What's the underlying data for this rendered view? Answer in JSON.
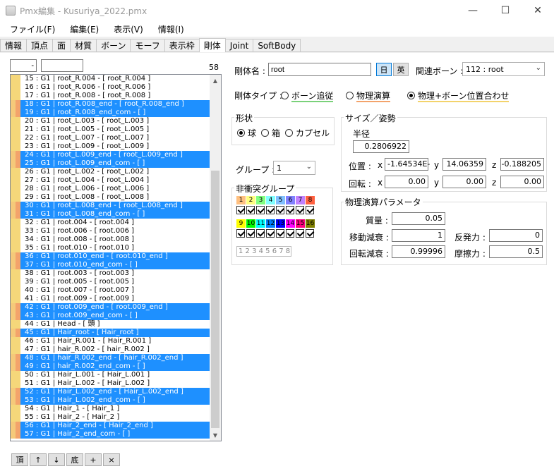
{
  "window": {
    "title": "Pmx編集 - Kusuriya_2022.pmx"
  },
  "menu": [
    "ファイル(F)",
    "編集(E)",
    "表示(V)",
    "情報(I)"
  ],
  "tabs": [
    "情報",
    "頂点",
    "面",
    "材質",
    "ボーン",
    "モーフ",
    "表示枠",
    "剛体",
    "Joint",
    "SoftBody"
  ],
  "active_tab": "剛体",
  "list": {
    "filter_value": "-",
    "count": "58",
    "rows": [
      {
        "t": "15 : G1  | root_R.004  - [ root_R.004 ]",
        "sel": false
      },
      {
        "t": "16 : G1  | root_R.006  - [ root_R.006 ]",
        "sel": false
      },
      {
        "t": "17 : G1  | root_R.008  - [ root_R.008 ]",
        "sel": false
      },
      {
        "t": "18 : G1  | root_R.008_end  - [ root_R.008_end ]",
        "sel": true
      },
      {
        "t": "19 : G1  | root_R.008_end_com  - [  ]",
        "sel": true
      },
      {
        "t": "20 : G1  | root_L.003  - [ root_L.003 ]",
        "sel": false
      },
      {
        "t": "21 : G1  | root_L.005  - [ root_L.005 ]",
        "sel": false
      },
      {
        "t": "22 : G1  | root_L.007  - [ root_L.007 ]",
        "sel": false
      },
      {
        "t": "23 : G1  | root_L.009  - [ root_L.009 ]",
        "sel": false
      },
      {
        "t": "24 : G1  | root_L.009_end  - [ root_L.009_end ]",
        "sel": true
      },
      {
        "t": "25 : G1  | root_L.009_end_com  - [  ]",
        "sel": true
      },
      {
        "t": "26 : G1  | root_L.002  - [ root_L.002 ]",
        "sel": false
      },
      {
        "t": "27 : G1  | root_L.004  - [ root_L.004 ]",
        "sel": false
      },
      {
        "t": "28 : G1  | root_L.006  - [ root_L.006 ]",
        "sel": false
      },
      {
        "t": "29 : G1  | root_L.008  - [ root_L.008 ]",
        "sel": false
      },
      {
        "t": "30 : G1  | root_L.008_end  - [ root_L.008_end ]",
        "sel": true
      },
      {
        "t": "31 : G1  | root_L.008_end_com  - [  ]",
        "sel": true
      },
      {
        "t": "32 : G1  | root.004  - [ root.004 ]",
        "sel": false
      },
      {
        "t": "33 : G1  | root.006  - [ root.006 ]",
        "sel": false
      },
      {
        "t": "34 : G1  | root.008  - [ root.008 ]",
        "sel": false
      },
      {
        "t": "35 : G1  | root.010  - [ root.010 ]",
        "sel": false
      },
      {
        "t": "36 : G1  | root.010_end  - [ root.010_end ]",
        "sel": true
      },
      {
        "t": "37 : G1  | root.010_end_com  - [  ]",
        "sel": true
      },
      {
        "t": "38 : G1  | root.003  - [ root.003 ]",
        "sel": false
      },
      {
        "t": "39 : G1  | root.005  - [ root.005 ]",
        "sel": false
      },
      {
        "t": "40 : G1  | root.007  - [ root.007 ]",
        "sel": false
      },
      {
        "t": "41 : G1  | root.009  - [ root.009 ]",
        "sel": false
      },
      {
        "t": "42 : G1  | root.009_end  - [ root.009_end ]",
        "sel": true
      },
      {
        "t": "43 : G1  | root.009_end_com  - [  ]",
        "sel": true
      },
      {
        "t": "44 : G1  | Head  - [ 頭 ]",
        "sel": false
      },
      {
        "t": "45 : G1  | Hair_root  - [ Hair_root ]",
        "sel": true
      },
      {
        "t": "46 : G1  | Hair_R.001  - [ Hair_R.001 ]",
        "sel": false
      },
      {
        "t": "47 : G1  | hair_R.002  - [ hair_R.002 ]",
        "sel": false
      },
      {
        "t": "48 : G1  | hair_R.002_end  - [ hair_R.002_end ]",
        "sel": true
      },
      {
        "t": "49 : G1  | hair_R.002_end_com  - [  ]",
        "sel": true
      },
      {
        "t": "50 : G1  | Hair_L.001  - [ Hair_L.001 ]",
        "sel": false
      },
      {
        "t": "51 : G1  | Hair_L.002  - [ Hair_L.002 ]",
        "sel": false
      },
      {
        "t": "52 : G1  | Hair_L.002_end  - [ Hair_L.002_end ]",
        "sel": true
      },
      {
        "t": "53 : G1  | Hair_L.002_end_com  - [  ]",
        "sel": true
      },
      {
        "t": "54 : G1  | Hair_1  - [ Hair_1 ]",
        "sel": false
      },
      {
        "t": "55 : G1  | Hair_2  - [ Hair_2 ]",
        "sel": false
      },
      {
        "t": "56 : G1  | Hair_2_end  - [ Hair_2_end ]",
        "sel": true
      },
      {
        "t": "57 : G1  | Hair_2_end_com  - [  ]",
        "sel": true
      }
    ],
    "buttons": [
      "頂",
      "↑",
      "↓",
      "底",
      "+",
      "×"
    ]
  },
  "props": {
    "name_label": "剛体名 :",
    "name_value": "root",
    "lang_jp": "日",
    "lang_en": "英",
    "bone_label": "関連ボーン :",
    "bone_value": "112 : root",
    "type_label": "剛体タイプ :",
    "type_options": [
      "ボーン追従",
      "物理演算",
      "物理+ボーン位置合わせ"
    ],
    "type_selected": 2,
    "shape_title": "形状",
    "shape_options": [
      "球",
      "箱",
      "カプセル"
    ],
    "shape_selected": 0,
    "size_title": "サイズ／姿勢",
    "radius_label": "半径",
    "radius_value": "0.2806922",
    "pos_label": "位置 :",
    "rot_label": "回転 :",
    "x_label": "x",
    "y_label": "y",
    "z_label": "z",
    "pos": {
      "x": "-1.64534E-",
      "y": "14.06359",
      "z": "-0.188205"
    },
    "rot": {
      "x": "0.00",
      "y": "0.00",
      "z": "0.00"
    },
    "group_label": "グループ :",
    "group_value": "1",
    "nocollide_title": "非衝突グループ",
    "groups_row1": [
      "1",
      "2",
      "3",
      "4",
      "5",
      "6",
      "7",
      "8"
    ],
    "groups_row2": [
      "9",
      "10",
      "11",
      "12",
      "13",
      "14",
      "15",
      "16"
    ],
    "group_colors1": [
      "#ffc080",
      "#ffff80",
      "#80ff80",
      "#80ffff",
      "#80c0ff",
      "#8080ff",
      "#c080ff",
      "#ff6040"
    ],
    "group_colors2": [
      "#ffff00",
      "#00ff00",
      "#00ffff",
      "#0080ff",
      "#0000ff",
      "#ff00ff",
      "#ff0080",
      "#808000"
    ],
    "group_text": "1 2 3 4 5 6 7 8",
    "physics_title": "物理演算パラメータ",
    "mass_label": "質量 :",
    "mass_value": "0.05",
    "move_damp_label": "移動減衰 :",
    "move_damp_value": "1",
    "rot_damp_label": "回転減衰 :",
    "rot_damp_value": "0.99996",
    "restitution_label": "反発力 :",
    "restitution_value": "0",
    "friction_label": "摩擦力 :",
    "friction_value": "0.5"
  }
}
